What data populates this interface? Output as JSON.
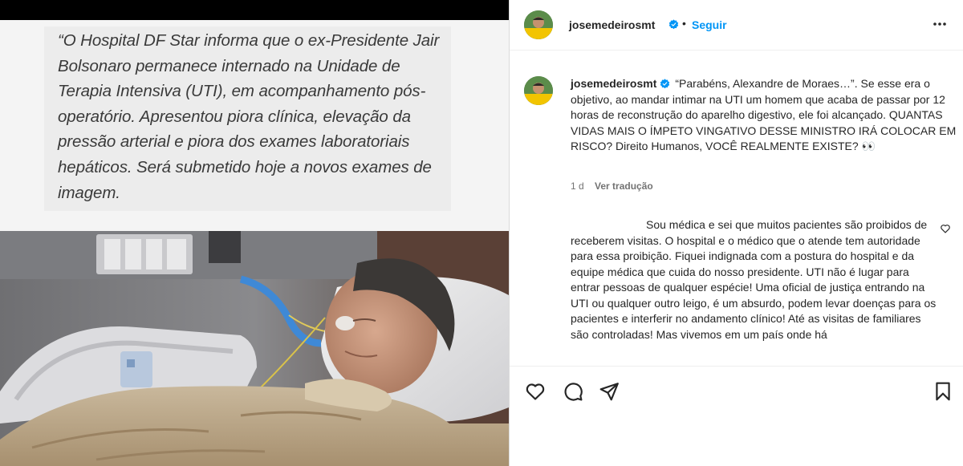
{
  "media": {
    "quote_text": "“O Hospital DF Star informa que o ex-Presidente Jair Bolsonaro permanece internado na Unidade de Terapia Intensiva (UTI), em acompanhamento pós-operatório. Apresentou piora clínica, elevação da pressão arterial e piora dos exames laboratoriais hepáticos. Será submetido hoje a novos exames de imagem."
  },
  "header": {
    "username": "josemedeirosmt",
    "dot": "•",
    "follow_label": "Seguir",
    "more_icon": "more-horizontal-icon"
  },
  "caption": {
    "username": "josemedeirosmt",
    "text": "“Parabéns, Alexandre de Moraes…”. Se esse era o objetivo, ao mandar intimar na UTI um homem que acaba de passar por 12 horas de reconstrução do aparelho digestivo, ele foi alcançado. QUANTAS VIDAS MAIS O ÍMPETO VINGATIVO DESSE MINISTRO IRÁ COLOCAR EM RISCO? Direito Humanos, VOCÊ REALMENTE EXISTE? 👀",
    "time": "1 d",
    "translate_label": "Ver tradução"
  },
  "comment": {
    "text": "Sou médica e sei que muitos pacientes são proibidos de receberem visitas. O hospital e o médico que o atende tem autoridade para essa proibição. Fiquei indignada com a postura do hospital e da equipe médica que cuida do nosso presidente. UTI não é lugar para entrar pessoas de qualquer espécie! Uma oficial de justiça entrando na UTI ou qualquer outro leigo, é um absurdo, podem levar doenças para os pacientes e interferir no andamento clínico! Até as visitas de familiares são controladas! Mas vivemos em um país onde há"
  },
  "actions": {
    "like_icon": "heart-icon",
    "comment_icon": "comment-icon",
    "share_icon": "send-icon",
    "save_icon": "bookmark-icon"
  },
  "colors": {
    "accent": "#0095f6",
    "verified": "#0095f6",
    "text": "#262626",
    "muted": "#737373"
  }
}
